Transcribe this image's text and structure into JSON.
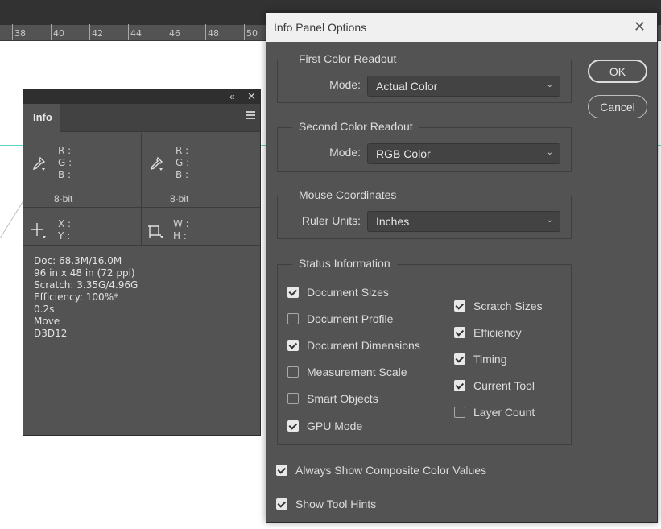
{
  "ruler": {
    "labels": [
      "38",
      "40",
      "42",
      "44",
      "46",
      "48",
      "50"
    ]
  },
  "info_panel": {
    "tab_label": "Info",
    "collapse_icon": "double-chevron-left-icon",
    "close_icon": "close-icon",
    "menu_icon": "hamburger-menu-icon",
    "color1": {
      "r": "R :",
      "g": "G :",
      "b": "B :",
      "bitdepth": "8-bit"
    },
    "color2": {
      "r": "R :",
      "g": "G :",
      "b": "B :",
      "bitdepth": "8-bit"
    },
    "coords": {
      "x": "X :",
      "y": "Y :"
    },
    "size": {
      "w": "W :",
      "h": "H :"
    },
    "status": [
      "Doc: 68.3M/16.0M",
      "96 in x 48 in (72 ppi)",
      "Scratch: 3.35G/4.96G",
      "Efficiency: 100%*",
      "0.2s",
      "Move",
      "D3D12"
    ]
  },
  "dialog": {
    "title": "Info Panel Options",
    "ok_label": "OK",
    "cancel_label": "Cancel",
    "first_color": {
      "legend": "First Color Readout",
      "label": "Mode:",
      "value": "Actual Color"
    },
    "second_color": {
      "legend": "Second Color Readout",
      "label": "Mode:",
      "value": "RGB Color"
    },
    "mouse": {
      "legend": "Mouse Coordinates",
      "label": "Ruler Units:",
      "value": "Inches"
    },
    "status": {
      "legend": "Status Information",
      "left": [
        {
          "label": "Document Sizes",
          "checked": true
        },
        {
          "label": "Document Profile",
          "checked": false
        },
        {
          "label": "Document Dimensions",
          "checked": true
        },
        {
          "label": "Measurement Scale",
          "checked": false
        },
        {
          "label": "Smart Objects",
          "checked": false
        },
        {
          "label": "GPU Mode",
          "checked": true
        }
      ],
      "right": [
        {
          "label": "Scratch Sizes",
          "checked": true
        },
        {
          "label": "Efficiency",
          "checked": true
        },
        {
          "label": "Timing",
          "checked": true
        },
        {
          "label": "Current Tool",
          "checked": true
        },
        {
          "label": "Layer Count",
          "checked": false
        }
      ]
    },
    "composite": {
      "label": "Always Show Composite Color Values",
      "checked": true
    },
    "hints": {
      "label": "Show Tool Hints",
      "checked": true
    }
  },
  "colors": {
    "panel": "#535353",
    "dark": "#323232",
    "guide": "#5fd1c6",
    "dialog_title_bg": "#f0f0f0"
  }
}
